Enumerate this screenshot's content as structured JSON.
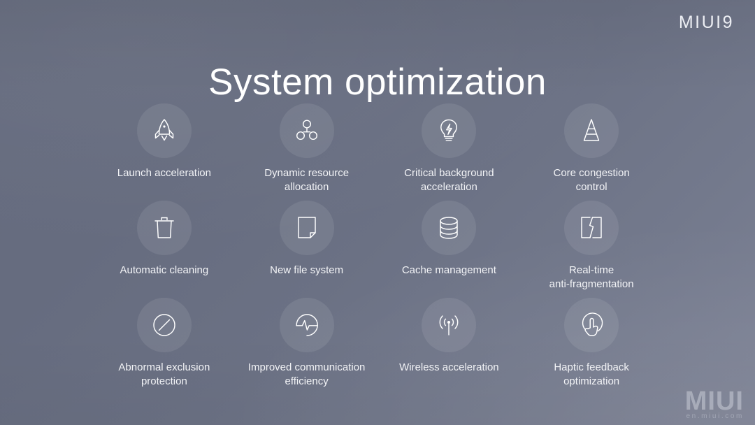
{
  "slide": {
    "title": "System optimization",
    "brand_logo": "MIUI9",
    "background_color": "#6b7184",
    "accent_color": "#ffffff"
  },
  "watermark": {
    "main": "MIUI",
    "sub": "en.miui.com"
  },
  "features": [
    {
      "label": "Launch acceleration",
      "icon": "rocket-icon"
    },
    {
      "label": "Dynamic resource\nallocation",
      "icon": "resource-nodes-icon"
    },
    {
      "label": "Critical background\nacceleration",
      "icon": "lightbulb-bolt-icon"
    },
    {
      "label": "Core congestion\ncontrol",
      "icon": "traffic-cone-icon"
    },
    {
      "label": "Automatic cleaning",
      "icon": "trash-can-icon"
    },
    {
      "label": "New file system",
      "icon": "file-document-icon"
    },
    {
      "label": "Cache management",
      "icon": "database-stack-icon"
    },
    {
      "label": "Real-time\nanti-fragmentation",
      "icon": "fragmented-square-icon"
    },
    {
      "label": "Abnormal exclusion\nprotection",
      "icon": "prohibition-circle-icon"
    },
    {
      "label": "Improved communication\nefficiency",
      "icon": "pulse-circle-icon"
    },
    {
      "label": "Wireless acceleration",
      "icon": "wireless-signal-icon"
    },
    {
      "label": "Haptic feedback\noptimization",
      "icon": "touch-hand-icon"
    }
  ]
}
